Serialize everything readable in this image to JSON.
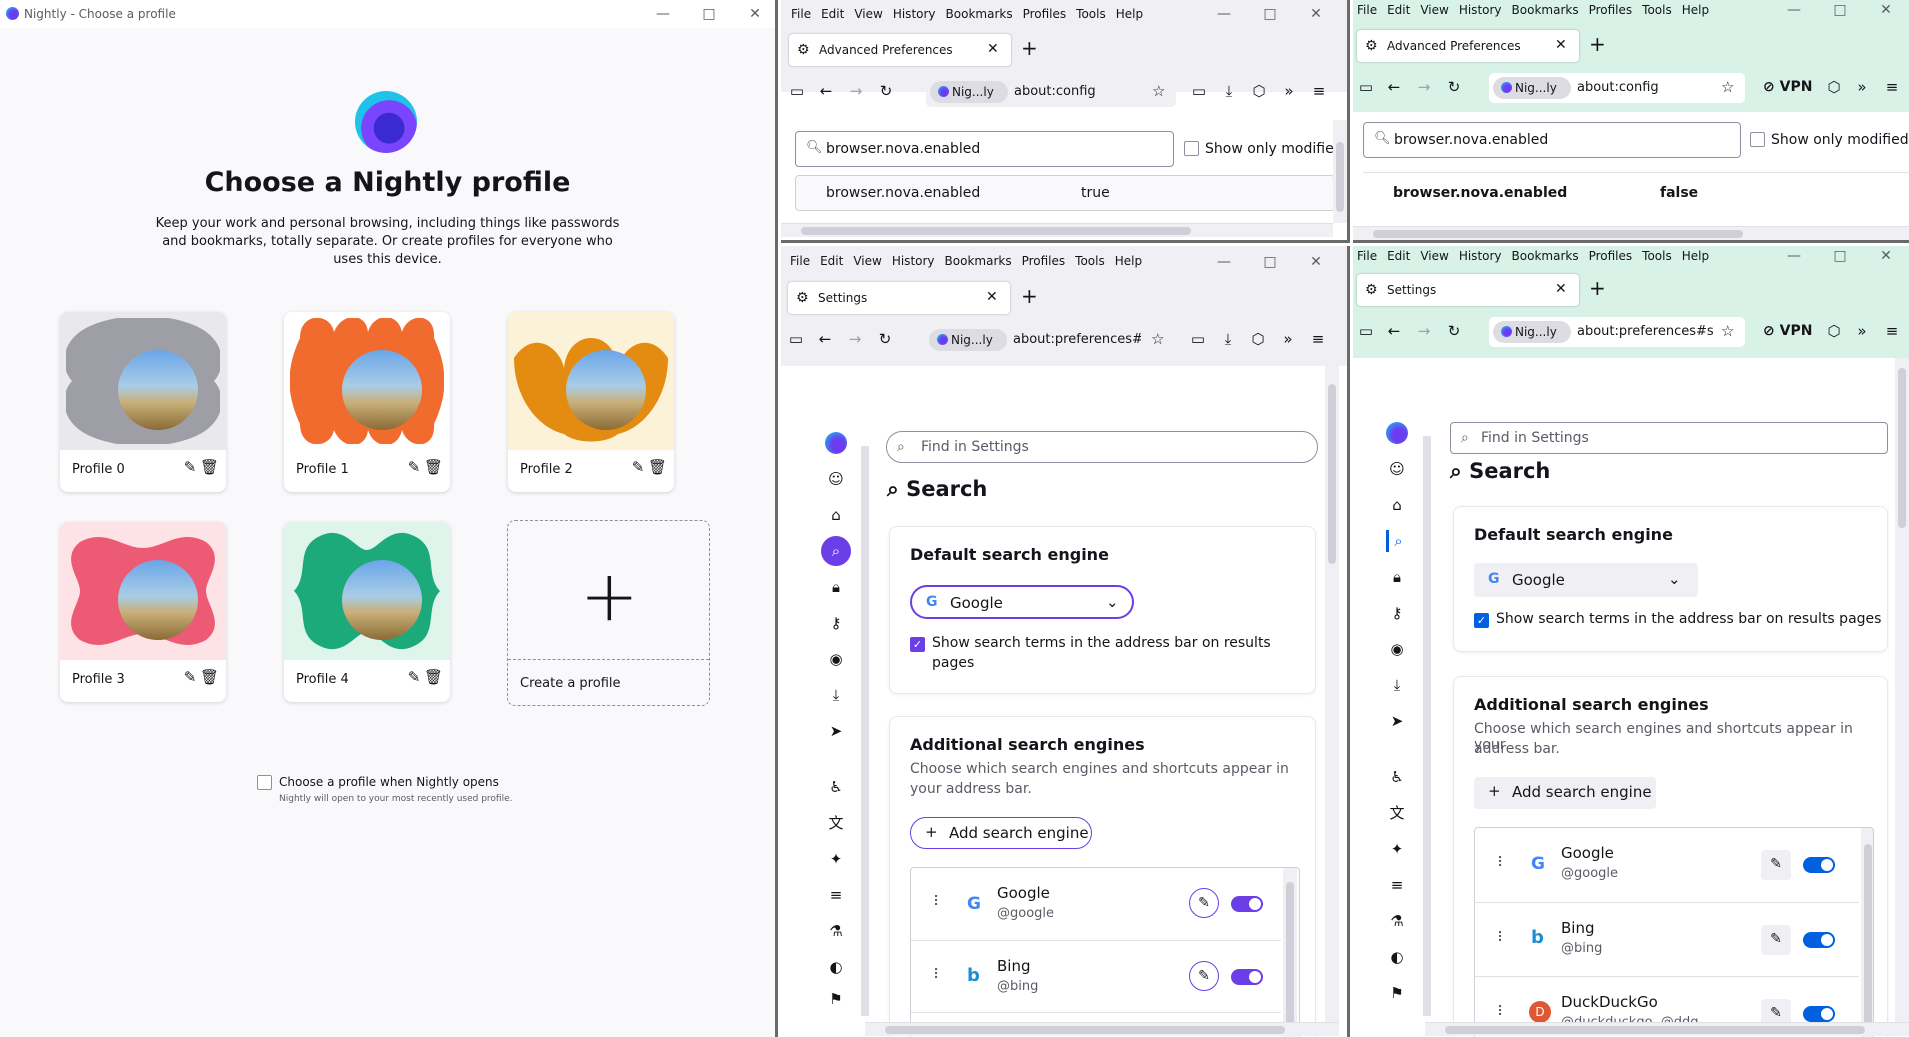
{
  "profile_window": {
    "title": "Nightly - Choose a profile",
    "heading": "Choose a Nightly profile",
    "subtitle": "Keep your work and personal browsing, including things like passwords and bookmarks, totally separate. Or create profiles for everyone who uses this device.",
    "profiles": [
      {
        "name": "Profile 0",
        "color": "#9e9ea6",
        "bg": "#e9e9ed"
      },
      {
        "name": "Profile 1",
        "color": "#f16b2e",
        "bg": "#ffffff"
      },
      {
        "name": "Profile 2",
        "color": "#e48b12",
        "bg": "#fbf2d8"
      },
      {
        "name": "Profile 3",
        "color": "#ec5a73",
        "bg": "#fde2e6"
      },
      {
        "name": "Profile 4",
        "color": "#1caa7a",
        "bg": "#dff5ec"
      }
    ],
    "create_label": "Create a profile",
    "choose_on_open": "Choose a profile when Nightly opens",
    "choose_note": "Nightly will open to your most recently used profile."
  },
  "menus": [
    "File",
    "Edit",
    "View",
    "History",
    "Bookmarks",
    "Profiles",
    "Tools",
    "Help"
  ],
  "identity_label": "Nig...ly",
  "config_tab": "Advanced Preferences",
  "config_url": "about:config",
  "config_search": "browser.nova.enabled",
  "show_only_modified_a": "Show only modifie",
  "show_only_modified_b": "Show only modified",
  "pref_name": "browser.nova.enabled",
  "pref_value_a": "true",
  "pref_value_b": "false",
  "settings_tab": "Settings",
  "settings_url_a": "about:preferences#s",
  "settings_url_b": "about:preferences#se",
  "vpn_label": "VPN",
  "find_placeholder": "Find in Settings",
  "search_heading": "Search",
  "default_engine_heading": "Default search engine",
  "default_engine": "Google",
  "show_terms": "Show search terms in the address bar on results pages",
  "show_terms_a1": "Show search terms in the address bar on results",
  "show_terms_a2": "pages",
  "additional_heading": "Additional search engines",
  "additional_desc": "Choose which search engines and shortcuts appear in your address bar.",
  "additional_desc_a1": "Choose which search engines and shortcuts appear in",
  "additional_desc_a2": "your address bar.",
  "additional_desc_b1": "Choose which search engines and shortcuts appear in your",
  "additional_desc_b2": "address bar.",
  "add_engine": "Add search engine",
  "engines": [
    {
      "name": "Google",
      "alias": "@google"
    },
    {
      "name": "Bing",
      "alias": "@bing"
    },
    {
      "name": "DuckDuckGo",
      "alias": "@duckduckgo, @ddg"
    }
  ],
  "colors": {
    "accent_purple": "#6b3ee8",
    "accent_blue": "#0060df",
    "green_chrome": "#d8f2e8"
  }
}
